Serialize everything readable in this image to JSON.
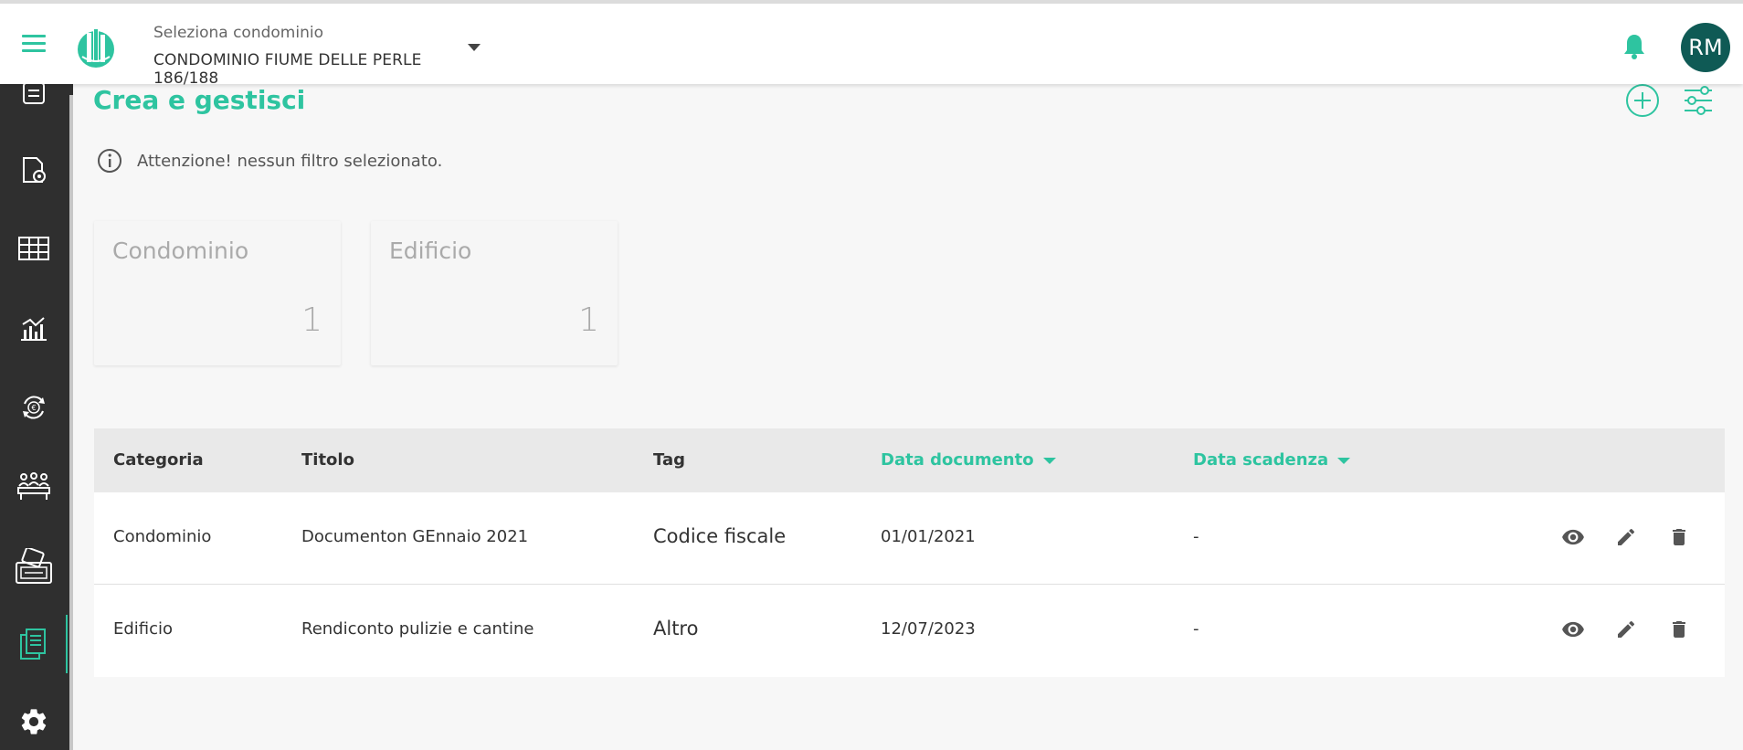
{
  "header": {
    "select_label": "Seleziona condominio",
    "select_value": "CONDOMINIO FIUME DELLE PERLE 186/188",
    "avatar_initials": "RM"
  },
  "colors": {
    "accent": "#2ec4a0",
    "sidebar": "#2f2f2f",
    "avatar": "#0f5a55"
  },
  "sidebar": {
    "items": [
      {
        "icon": "list-icon"
      },
      {
        "icon": "document-settings-icon"
      },
      {
        "icon": "table-icon"
      },
      {
        "icon": "chart-icon"
      },
      {
        "icon": "euro-exchange-icon"
      },
      {
        "icon": "people-meeting-icon"
      },
      {
        "icon": "payment-card-icon"
      },
      {
        "icon": "documents-icon",
        "active": true
      },
      {
        "icon": "gear-icon"
      }
    ]
  },
  "main": {
    "title": "Crea e gestisci",
    "info_text": "Attenzione! nessun filtro selezionato.",
    "cards": [
      {
        "title": "Condominio",
        "value": "1"
      },
      {
        "title": "Edificio",
        "value": "1"
      }
    ]
  },
  "table": {
    "headers": {
      "categoria": "Categoria",
      "titolo": "Titolo",
      "tag": "Tag",
      "data_documento": "Data documento",
      "data_scadenza": "Data scadenza"
    },
    "rows": [
      {
        "categoria": "Condominio",
        "titolo": "Documenton GEnnaio 2021",
        "tag": "Codice fiscale",
        "data_documento": "01/01/2021",
        "data_scadenza": "-"
      },
      {
        "categoria": "Edificio",
        "titolo": "Rendiconto pulizie e cantine",
        "tag": "Altro",
        "data_documento": "12/07/2023",
        "data_scadenza": "-"
      }
    ]
  }
}
